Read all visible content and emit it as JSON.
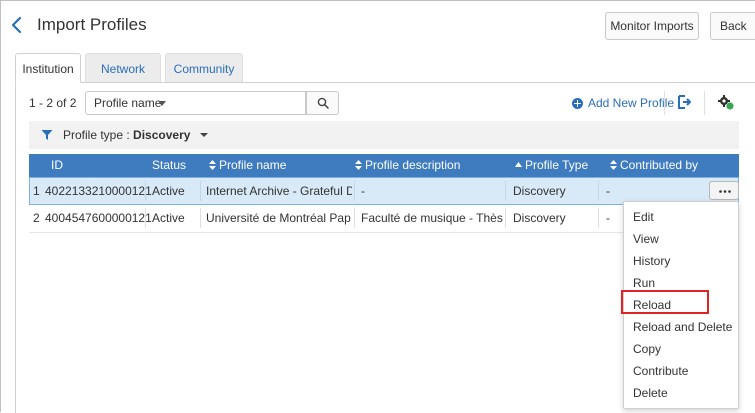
{
  "header": {
    "title": "Import Profiles",
    "monitor_imports_label": "Monitor Imports",
    "back_label": "Back"
  },
  "tabs": [
    {
      "label": "Institution",
      "active": true
    },
    {
      "label": "Network",
      "active": false
    },
    {
      "label": "Community",
      "active": false
    }
  ],
  "toolbar": {
    "count": "1 - 2 of 2",
    "search_field_select": "Profile name",
    "search_value": "",
    "add_new_label": "Add New Profile"
  },
  "filter": {
    "label": "Profile type :",
    "value": "Discovery"
  },
  "table": {
    "headers": {
      "id": "ID",
      "status": "Status",
      "profile_name": "Profile name",
      "profile_description": "Profile description",
      "profile_type": "Profile Type",
      "contributed_by": "Contributed by"
    },
    "rows": [
      {
        "num": "1",
        "id": "4022133210000121",
        "status": "Active",
        "profile_name": "Internet Archive - Grateful Dead",
        "profile_description": "-",
        "profile_type": "Discovery",
        "contributed_by": "-"
      },
      {
        "num": "2",
        "id": "4004547600000121",
        "status": "Active",
        "profile_name": "Université de Montréal Pap…",
        "profile_description": "Faculté de musique - Thèse…",
        "profile_type": "Discovery",
        "contributed_by": "-"
      }
    ]
  },
  "row_menu": {
    "items": [
      "Edit",
      "View",
      "History",
      "Run",
      "Reload",
      "Reload and Delete",
      "Copy",
      "Contribute",
      "Delete"
    ],
    "highlighted": "Reload"
  },
  "colors": {
    "accent": "#2a6ebb",
    "header_row": "#3e7bbf",
    "selected_row": "#d8e9f8",
    "highlight": "#e02424",
    "settings_green": "#3aa655"
  },
  "icons": [
    "chevron-left-icon",
    "search-icon",
    "plus-circle-icon",
    "export-icon",
    "settings-icon",
    "filter-icon",
    "sort-icon",
    "more-icon"
  ]
}
